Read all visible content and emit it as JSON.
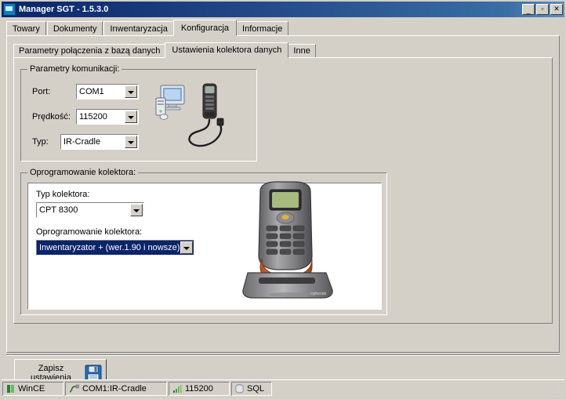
{
  "window": {
    "title": "Manager SGT - 1.5.3.0",
    "icon": "app-icon",
    "buttons": {
      "minimize": "_",
      "maximize": "▫",
      "close": "✕"
    }
  },
  "tabs": [
    {
      "label": "Towary",
      "selected": false
    },
    {
      "label": "Dokumenty",
      "selected": false
    },
    {
      "label": "Inwentaryzacja",
      "selected": false
    },
    {
      "label": "Konfiguracja",
      "selected": true
    },
    {
      "label": "Informacje",
      "selected": false
    }
  ],
  "inner_tabs": [
    {
      "label": "Parametry połączenia z bazą danych",
      "selected": false
    },
    {
      "label": "Ustawienia kolektora danych",
      "selected": true
    },
    {
      "label": "Inne",
      "selected": false
    }
  ],
  "comm_group": {
    "title": "Parametry komunikacji:",
    "port_label": "Port:",
    "port_value": "COM1",
    "speed_label": "Prędkość:",
    "speed_value": "115200",
    "type_label": "Typ:",
    "type_value": "IR-Cradle"
  },
  "software_group": {
    "title": "Oprogramowanie kolektora:",
    "collector_type_label": "Typ kolektora:",
    "collector_type_value": "CPT 8300",
    "collector_software_label": "Oprogramowanie kolektora:",
    "collector_software_value": "Inwentaryzator + (wer.1.90 i nowsze)"
  },
  "save_button": {
    "line1": "Zapisz",
    "line2": "ustawienia",
    "icon": "floppy-disk-icon"
  },
  "statusbar": [
    {
      "icon": "wince-icon",
      "text": "WinCE"
    },
    {
      "icon": "cable-icon",
      "text": "COM1:IR-Cradle"
    },
    {
      "icon": "signal-icon",
      "text": "115200"
    },
    {
      "icon": "sql-icon",
      "text": "SQL"
    }
  ],
  "colors": {
    "titlebar_start": "#0a246a",
    "face": "#d4d0c8",
    "selection": "#0a246a",
    "white": "#ffffff"
  }
}
